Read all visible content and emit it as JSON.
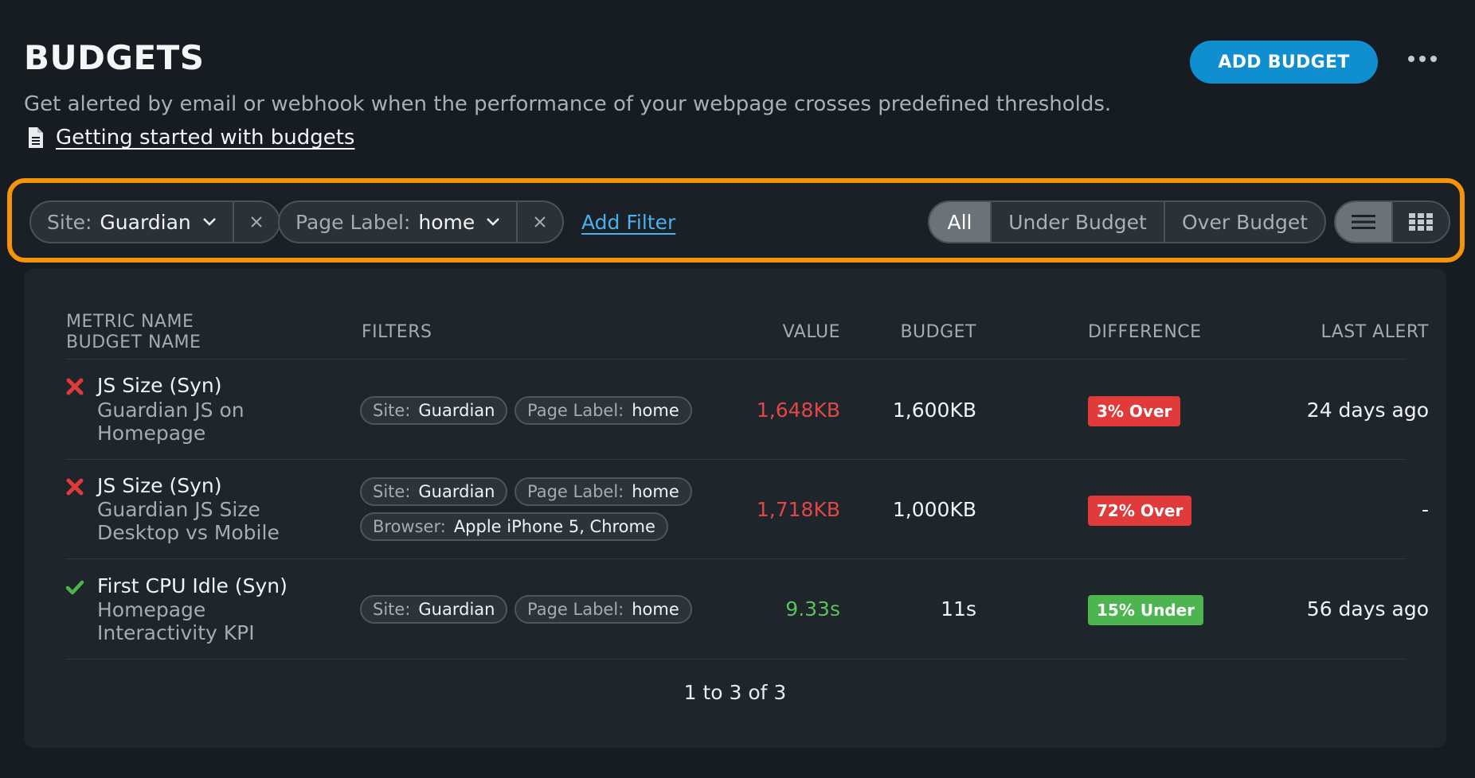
{
  "header": {
    "title": "BUDGETS",
    "subtitle": "Get alerted by email or webhook when the performance of your webpage crosses predefined thresholds.",
    "guide_link": "Getting started with budgets",
    "add_button": "ADD BUDGET"
  },
  "filters": {
    "chips": [
      {
        "key": "Site:",
        "value": "Guardian"
      },
      {
        "key": "Page Label:",
        "value": "home"
      }
    ],
    "add_filter": "Add Filter",
    "segments": [
      "All",
      "Under Budget",
      "Over Budget"
    ],
    "active_segment": "All"
  },
  "table": {
    "headers": {
      "metric_name": "METRIC NAME",
      "budget_name": "BUDGET NAME",
      "filters": "FILTERS",
      "value": "VALUE",
      "budget": "BUDGET",
      "difference": "DIFFERENCE",
      "last_alert": "LAST ALERT"
    },
    "rows": [
      {
        "status": "over",
        "metric": "JS Size (Syn)",
        "budget_name_lines": [
          "Guardian JS on",
          "Homepage"
        ],
        "tags": [
          {
            "key": "Site:",
            "value": "Guardian"
          },
          {
            "key": "Page Label:",
            "value": "home"
          }
        ],
        "value": "1,648KB",
        "budget": "1,600KB",
        "difference": "3% Over",
        "last_alert": "24 days ago"
      },
      {
        "status": "over",
        "metric": "JS Size (Syn)",
        "budget_name_lines": [
          "Guardian JS Size",
          "Desktop vs Mobile"
        ],
        "tags": [
          {
            "key": "Site:",
            "value": "Guardian"
          },
          {
            "key": "Page Label:",
            "value": "home"
          },
          {
            "key": "Browser:",
            "value": "Apple iPhone 5, Chrome"
          }
        ],
        "value": "1,718KB",
        "budget": "1,000KB",
        "difference": "72% Over",
        "last_alert": "-"
      },
      {
        "status": "under",
        "metric": "First CPU Idle (Syn)",
        "budget_name_lines": [
          "Homepage",
          "Interactivity KPI"
        ],
        "tags": [
          {
            "key": "Site:",
            "value": "Guardian"
          },
          {
            "key": "Page Label:",
            "value": "home"
          }
        ],
        "value": "9.33s",
        "budget": "11s",
        "difference": "15% Under",
        "last_alert": "56 days ago"
      }
    ],
    "pagination": "1 to 3 of 3"
  },
  "colors": {
    "accent_blue": "#0f8ed0",
    "link_blue": "#4db0ee",
    "highlight_orange": "#f5930b",
    "over_red": "#e03a3a",
    "under_green": "#4cb54f",
    "value_red": "#e04848",
    "value_green": "#5cbf5e"
  },
  "icons": {
    "doc": "document-icon",
    "more": "more-icon",
    "chevron": "chevron-down-icon",
    "clear": "close-icon",
    "list_view": "list-view-icon",
    "grid_view": "grid-view-icon",
    "over": "cross-icon",
    "under": "check-icon"
  }
}
